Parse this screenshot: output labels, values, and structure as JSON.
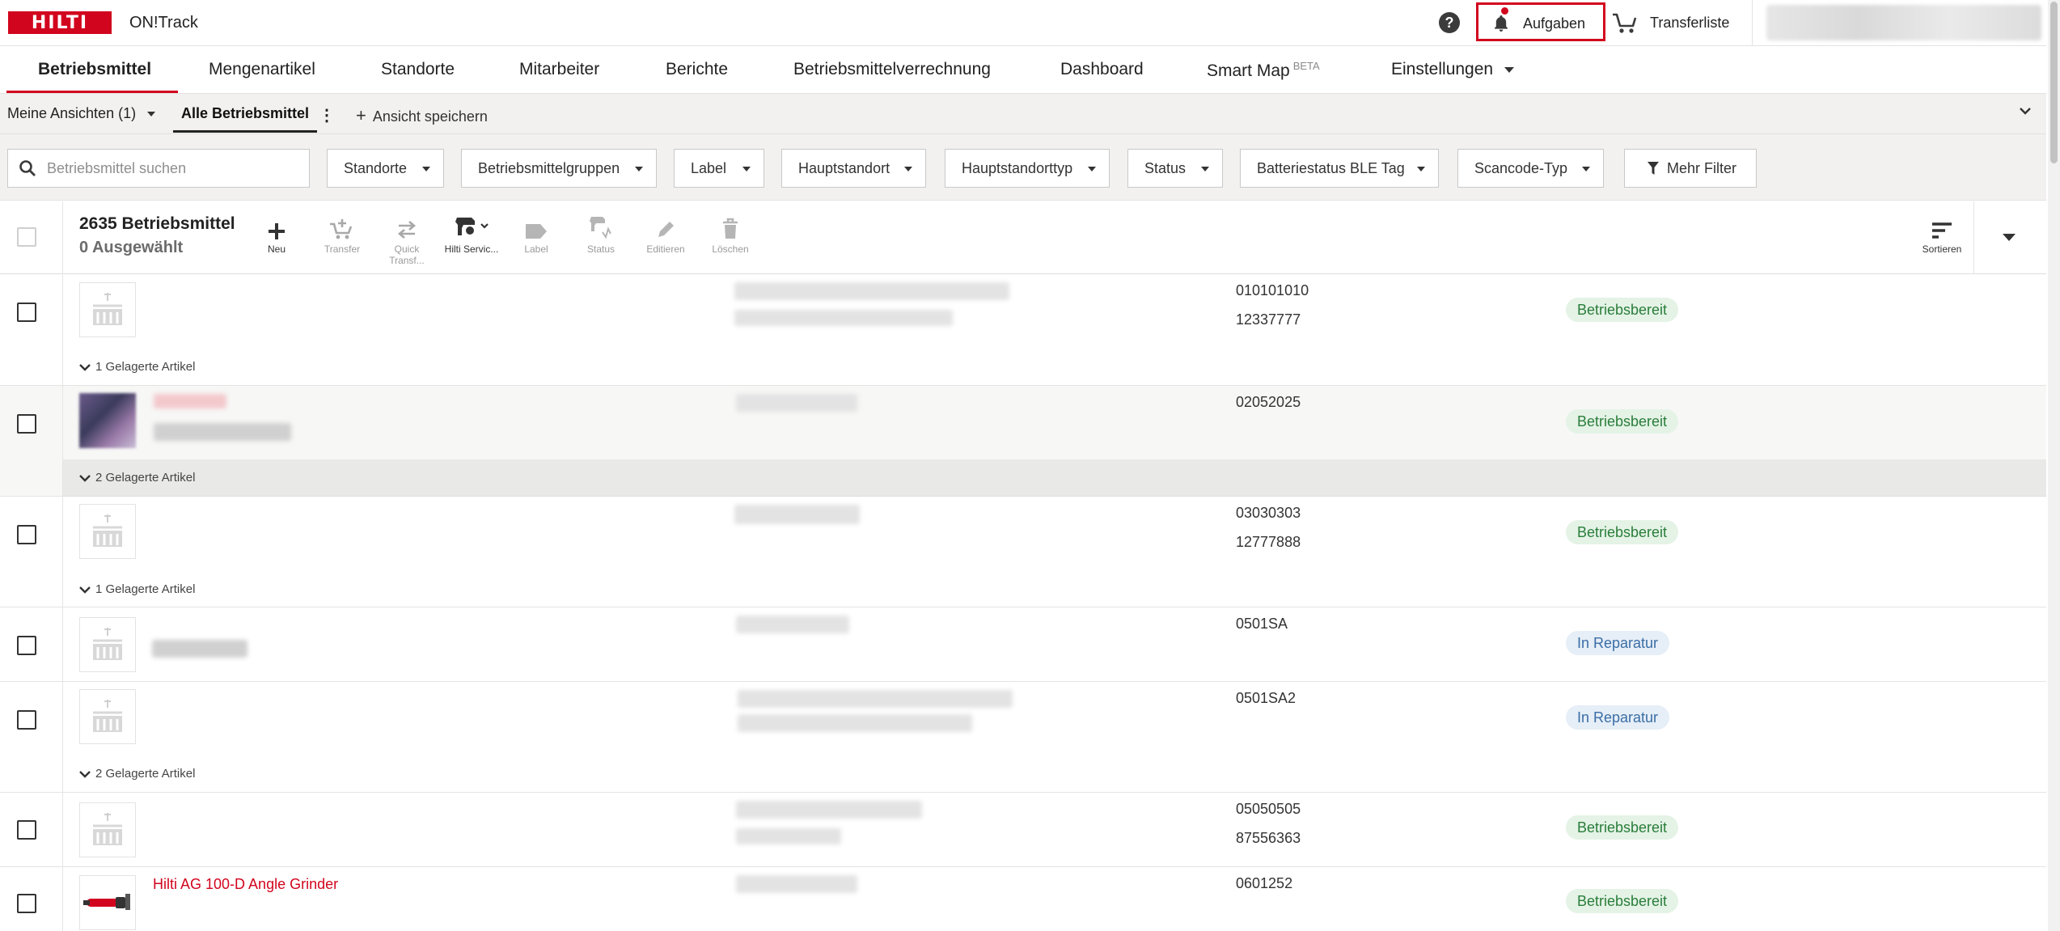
{
  "topbar": {
    "logo_text": "HILTI",
    "app_title": "ON!Track",
    "help_glyph": "?",
    "tasks_label": "Aufgaben",
    "transfer_label": "Transferliste"
  },
  "nav": {
    "items": [
      {
        "label": "Betriebsmittel",
        "active": true
      },
      {
        "label": "Mengenartikel"
      },
      {
        "label": "Standorte"
      },
      {
        "label": "Mitarbeiter"
      },
      {
        "label": "Berichte"
      },
      {
        "label": "Betriebsmittelverrechnung"
      },
      {
        "label": "Dashboard"
      },
      {
        "label": "Smart Map"
      },
      {
        "label": "Einstellungen"
      }
    ],
    "beta": "BETA"
  },
  "views": {
    "my_views": "Meine Ansichten (1)",
    "all_label": "Alle Betriebsmittel",
    "kebab": "⋮",
    "save_plus": "+",
    "save_label": "Ansicht speichern"
  },
  "filters": {
    "search_placeholder": "Betriebsmittel suchen",
    "buttons": [
      "Standorte",
      "Betriebsmittelgruppen",
      "Label",
      "Hauptstandort",
      "Hauptstandorttyp",
      "Status",
      "Batteriestatus BLE Tag",
      "Scancode-Typ"
    ],
    "more": "Mehr Filter"
  },
  "toolbar": {
    "count": "2635 Betriebsmittel",
    "selected": "0 Ausgewählt",
    "actions": {
      "new": "Neu",
      "transfer": "Transfer",
      "quick_transfer": "Quick Transf...",
      "hilti_service": "Hilti Servic...",
      "label": "Label",
      "status": "Status",
      "edit": "Editieren",
      "delete": "Löschen"
    },
    "sort": "Sortieren"
  },
  "rows": [
    {
      "codes": [
        "010101010",
        "12337777"
      ],
      "status": "Betriebsbereit",
      "sub": "1 Gelagerte Artikel"
    },
    {
      "codes": [
        "02052025"
      ],
      "status": "Betriebsbereit",
      "sub": "2 Gelagerte Artikel"
    },
    {
      "codes": [
        "03030303",
        "12777888"
      ],
      "status": "Betriebsbereit",
      "sub": "1 Gelagerte Artikel"
    },
    {
      "codes": [
        "0501SA"
      ],
      "status": "In Reparatur"
    },
    {
      "codes": [
        "0501SA2"
      ],
      "status": "In Reparatur",
      "sub": "2 Gelagerte Artikel"
    },
    {
      "codes": [
        "05050505",
        "87556363"
      ],
      "status": "Betriebsbereit"
    },
    {
      "name": "Hilti AG 100-D Angle Grinder",
      "codes": [
        "0601252"
      ],
      "status": "Betriebsbereit"
    }
  ],
  "colors": {
    "brand_red": "#d2051e",
    "status_ok_bg": "#e4f3e6",
    "status_ok_text": "#2a7d3a",
    "status_repair_bg": "#e6eef7",
    "status_repair_text": "#3a6ea5"
  },
  "icons": {
    "bell": "bell-icon",
    "cart": "cart-icon",
    "help": "help-icon",
    "search": "search-icon",
    "filter": "filter-icon",
    "sort": "sort-icon"
  }
}
